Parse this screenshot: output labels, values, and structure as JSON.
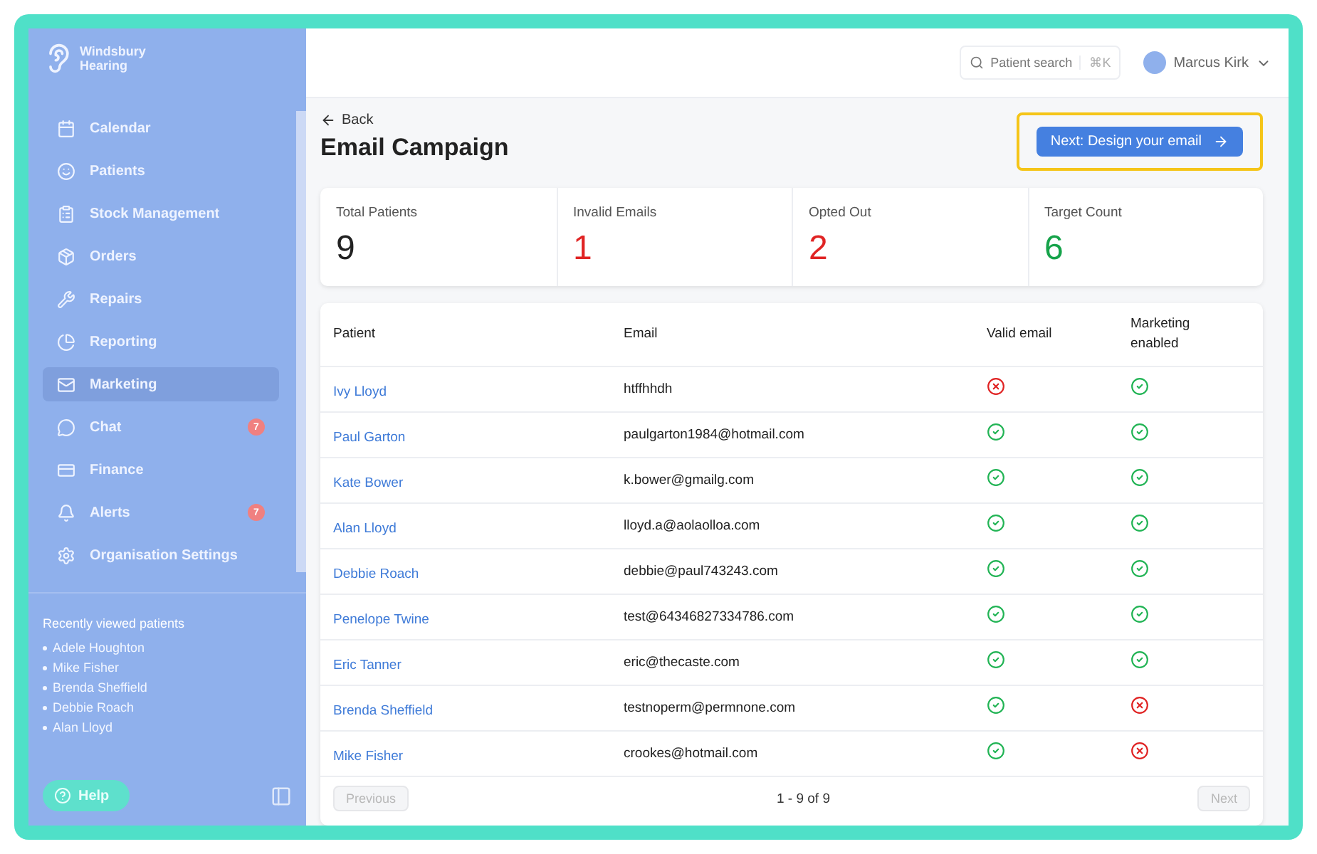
{
  "sidebar": {
    "brand": [
      "Windsbury",
      "Hearing"
    ],
    "items": [
      {
        "label": "Calendar",
        "selected": false
      },
      {
        "label": "Patients",
        "selected": false
      },
      {
        "label": "Stock Management",
        "selected": false
      },
      {
        "label": "Orders",
        "selected": false
      },
      {
        "label": "Repairs",
        "selected": false
      },
      {
        "label": "Reporting",
        "selected": false
      },
      {
        "label": "Marketing",
        "selected": true
      },
      {
        "label": "Chat",
        "selected": false,
        "badge": "7"
      },
      {
        "label": "Finance",
        "selected": false
      },
      {
        "label": "Alerts",
        "selected": false,
        "badge": "7"
      },
      {
        "label": "Organisation Settings",
        "selected": false
      }
    ],
    "recent_title": "Recently viewed patients",
    "recent": [
      "Adele Houghton",
      "Mike Fisher",
      "Brenda Sheffield",
      "Debbie Roach",
      "Alan Lloyd"
    ],
    "help": "Help"
  },
  "header": {
    "search_placeholder": "Patient search",
    "shortcut": "⌘K",
    "user": "Marcus Kirk"
  },
  "page": {
    "back": "Back",
    "title": "Email Campaign",
    "next_button": "Next: Design your email",
    "next_highlighted": true
  },
  "stats": [
    {
      "label": "Total Patients",
      "value": "9",
      "color": "#222222"
    },
    {
      "label": "Invalid Emails",
      "value": "1",
      "color": "#e02424"
    },
    {
      "label": "Opted Out",
      "value": "2",
      "color": "#e02424"
    },
    {
      "label": "Target Count",
      "value": "6",
      "color": "#16a34a"
    }
  ],
  "table": {
    "columns": [
      "Patient",
      "Email",
      "Valid email",
      "Marketing enabled"
    ],
    "rows": [
      {
        "patient": "Ivy Lloyd",
        "email": "htffhhdh",
        "valid": false,
        "marketing": true
      },
      {
        "patient": "Paul Garton",
        "email": "paulgarton1984@hotmail.com",
        "valid": true,
        "marketing": true
      },
      {
        "patient": "Kate Bower",
        "email": "k.bower@gmailg.com",
        "valid": true,
        "marketing": true
      },
      {
        "patient": "Alan Lloyd",
        "email": "lloyd.a@aolaolloa.com",
        "valid": true,
        "marketing": true
      },
      {
        "patient": "Debbie Roach",
        "email": "debbie@paul743243.com",
        "valid": true,
        "marketing": true
      },
      {
        "patient": "Penelope Twine",
        "email": "test@64346827334786.com",
        "valid": true,
        "marketing": true
      },
      {
        "patient": "Eric Tanner",
        "email": "eric@thecaste.com",
        "valid": true,
        "marketing": true
      },
      {
        "patient": "Brenda Sheffield",
        "email": "testnoperm@permnone.com",
        "valid": true,
        "marketing": false
      },
      {
        "patient": "Mike Fisher",
        "email": "crookes@hotmail.com",
        "valid": true,
        "marketing": false
      }
    ]
  },
  "pagination": {
    "previous": "Previous",
    "range": "1 - 9 of 9",
    "next": "Next",
    "previous_disabled": true,
    "next_disabled": true
  }
}
